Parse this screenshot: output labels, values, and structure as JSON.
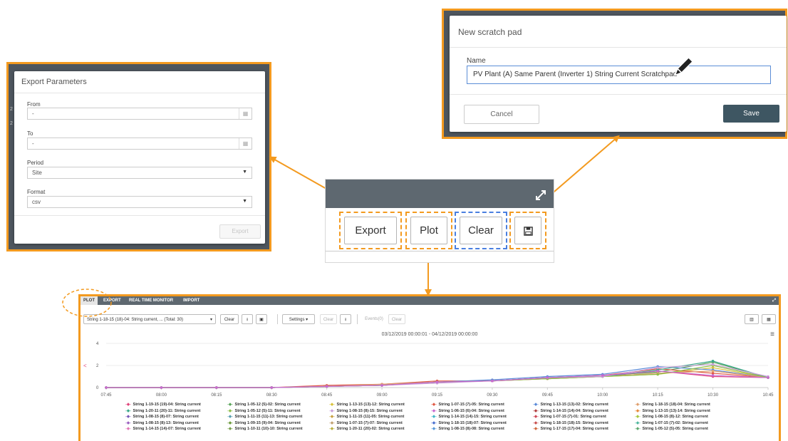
{
  "export_dialog": {
    "title": "Export Parameters",
    "from_label": "From",
    "from_value": "-",
    "to_label": "To",
    "to_value": "-",
    "period_label": "Period",
    "period_value": "Site",
    "format_label": "Format",
    "format_value": "csv",
    "export_button": "Export",
    "icons": [
      "calendar-icon",
      "chevron-down-icon"
    ]
  },
  "scratch_dialog": {
    "title": "New scratch pad",
    "name_label": "Name",
    "name_value": "PV Plant (A) Same Parent (Inverter 1) String Current Scratchpad",
    "cancel_button": "Cancel",
    "save_button": "Save",
    "save_color": "#3e5662"
  },
  "toolbar": {
    "export_label": "Export",
    "plot_label": "Plot",
    "clear_label": "Clear",
    "save_icon": "floppy-disk-icon",
    "expand_icon": "expand-arrows-icon"
  },
  "accent_color": "#f39a1f",
  "plot_panel": {
    "tabs": [
      "PLOT",
      "EXPORT",
      "REAL TIME MONITOR",
      "IMPORT"
    ],
    "series_selector": "String 1-18-15 (18)-04: String current, ... (Total: 30)",
    "clear_label": "Clear",
    "settings_label": "Settings",
    "clear2_label": "Clear",
    "events_label": "Events(0)",
    "clear3_label": "Clear",
    "date_range": "03/12/2019 00:00:01 - 04/12/2019 00:00:00",
    "legend": [
      "String 1-19-15 (19)-04: String current",
      "String 1-05-12 (5)-02: String current",
      "String 1-13-15 (13)-12: String current",
      "String 1-07-15 (7)-05: String current",
      "String 1-13-15 (13)-02: String current",
      "String 1-18-15 (18)-04: String current",
      "String 1-20-11 (20)-11: String current",
      "String 1-05-12 (5)-11: String current",
      "String 1-08-15 (8)-15: String current",
      "String 1-06-15 (6)-04: String current",
      "String 1-14-15 (14)-04: String current",
      "String 1-13-15 (13)-14: String current",
      "String 1-08-15 (8)-07: String current",
      "String 1-11-15 (11)-13: String current",
      "String 1-11-15 (11)-05: String current",
      "String 1-14-15 (14)-15: String current",
      "String 1-07-15 (7)-01: String current",
      "String 1-08-15 (8)-12: String current",
      "String 1-08-15 (8)-13: String current",
      "String 1-09-15 (9)-04: String current",
      "String 1-07-15 (7)-07: String current",
      "String 1-18-15 (18)-07: String current",
      "String 1-18-15 (18)-15: String current",
      "String 1-07-15 (7)-02: String current",
      "String 1-14-15 (14)-07: String current",
      "String 1-10-11 (10)-10: String current",
      "String 1-20-11 (20)-02: String current",
      "String 1-08-15 (8)-08: String current",
      "String 1-17-15 (17)-04: String current",
      "String 1-05-12 (5)-05: String current"
    ],
    "legend_colors": [
      "#e0457b",
      "#5aa55a",
      "#d8c23a",
      "#e05a45",
      "#5a8ad8",
      "#e0a070",
      "#3aa88a",
      "#8fbf4a",
      "#c9a0d8",
      "#c86ad0",
      "#b04040",
      "#e88a3a",
      "#7a5ab8",
      "#5aa0b0",
      "#c8a040",
      "#45b8c8",
      "#d04a5a",
      "#a8c840",
      "#9a60c0",
      "#6a9a3a",
      "#c0a070",
      "#4a70d0",
      "#c85050",
      "#50b8a0",
      "#e07ab8",
      "#7aa050",
      "#b8b040",
      "#5a9ad8",
      "#d06a40",
      "#60a870"
    ]
  },
  "chart_data": {
    "type": "line",
    "x": [
      "07:45",
      "08:00",
      "08:15",
      "08:30",
      "08:45",
      "09:00",
      "09:15",
      "09:30",
      "09:45",
      "10:00",
      "10:15",
      "10:30",
      "10:45"
    ],
    "ylim": [
      0,
      4
    ],
    "yticks": [
      0,
      2,
      4
    ],
    "series": [
      {
        "name": "String 1-19-15 (19)-04: String current",
        "values": [
          0,
          0,
          0,
          0,
          0.1,
          0.3,
          0.5,
          0.6,
          0.8,
          1.0,
          1.5,
          1.0,
          0.9
        ]
      },
      {
        "name": "String 1-05-12 (5)-02: String current",
        "values": [
          0,
          0,
          0,
          0,
          0.1,
          0.2,
          0.5,
          0.6,
          0.9,
          1.1,
          1.4,
          2.3,
          0.9
        ]
      },
      {
        "name": "String 1-13-15 (13)-12: String current",
        "values": [
          0,
          0,
          0,
          0,
          0.1,
          0.2,
          0.5,
          0.6,
          0.9,
          1.0,
          1.2,
          1.8,
          0.9
        ]
      },
      {
        "name": "String 1-07-15 (7)-05: String current",
        "values": [
          0,
          0,
          0,
          0,
          0.2,
          0.3,
          0.6,
          0.6,
          0.9,
          1.1,
          1.7,
          1.3,
          0.9
        ]
      },
      {
        "name": "String 1-13-15 (13)-02: String current",
        "values": [
          0,
          0,
          0,
          0,
          0.1,
          0.2,
          0.5,
          0.7,
          1.0,
          1.2,
          1.9,
          1.6,
          0.9
        ]
      },
      {
        "name": "String 1-18-15 (18)-04: String current",
        "values": [
          0,
          0,
          0,
          0,
          0.1,
          0.3,
          0.5,
          0.6,
          0.8,
          1.0,
          1.3,
          1.5,
          0.9
        ]
      },
      {
        "name": "String 1-20-11 (20)-11: String current",
        "values": [
          0,
          0,
          0,
          0,
          0.1,
          0.2,
          0.5,
          0.6,
          0.9,
          1.0,
          1.6,
          2.4,
          0.9
        ]
      },
      {
        "name": "String 1-05-12 (5)-11: String current",
        "values": [
          0,
          0,
          0,
          0,
          0.1,
          0.2,
          0.5,
          0.6,
          0.8,
          1.0,
          1.2,
          2.0,
          0.9
        ]
      },
      {
        "name": "String 1-08-15 (8)-15: String current",
        "values": [
          0,
          0,
          0,
          0,
          0.1,
          0.2,
          0.4,
          0.6,
          0.9,
          1.0,
          1.8,
          2.1,
          1.0
        ]
      },
      {
        "name": "String 1-06-15 (6)-04: String current",
        "values": [
          0,
          0,
          0,
          0,
          0.1,
          0.2,
          0.5,
          0.6,
          0.9,
          1.1,
          1.5,
          1.1,
          0.9
        ]
      }
    ]
  }
}
